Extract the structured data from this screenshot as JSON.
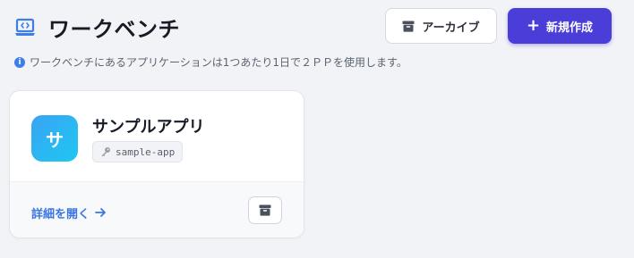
{
  "header": {
    "title": "ワークベンチ",
    "title_icon": "laptop-code-icon",
    "archive_label": "アーカイブ",
    "archive_icon": "archive-box-icon",
    "new_label": "新規作成",
    "new_icon": "plus-icon"
  },
  "info": {
    "icon": "info-circle-icon",
    "text": "ワークベンチにあるアプリケーションは1つあたり1日で２ＰＰを使用します。"
  },
  "apps": [
    {
      "avatar_letter": "サ",
      "name": "サンプルアプリ",
      "slug_icon": "key-icon",
      "slug": "sample-app",
      "details_label": "詳細を開く",
      "details_icon": "arrow-right-icon",
      "archive_icon": "archive-box-icon"
    }
  ],
  "colors": {
    "accent": "#4b3dd8",
    "link": "#3b76e1",
    "avatar_gradient_start": "#3aa3f5",
    "avatar_gradient_end": "#1ec8f0",
    "background": "#f1f3f7"
  }
}
